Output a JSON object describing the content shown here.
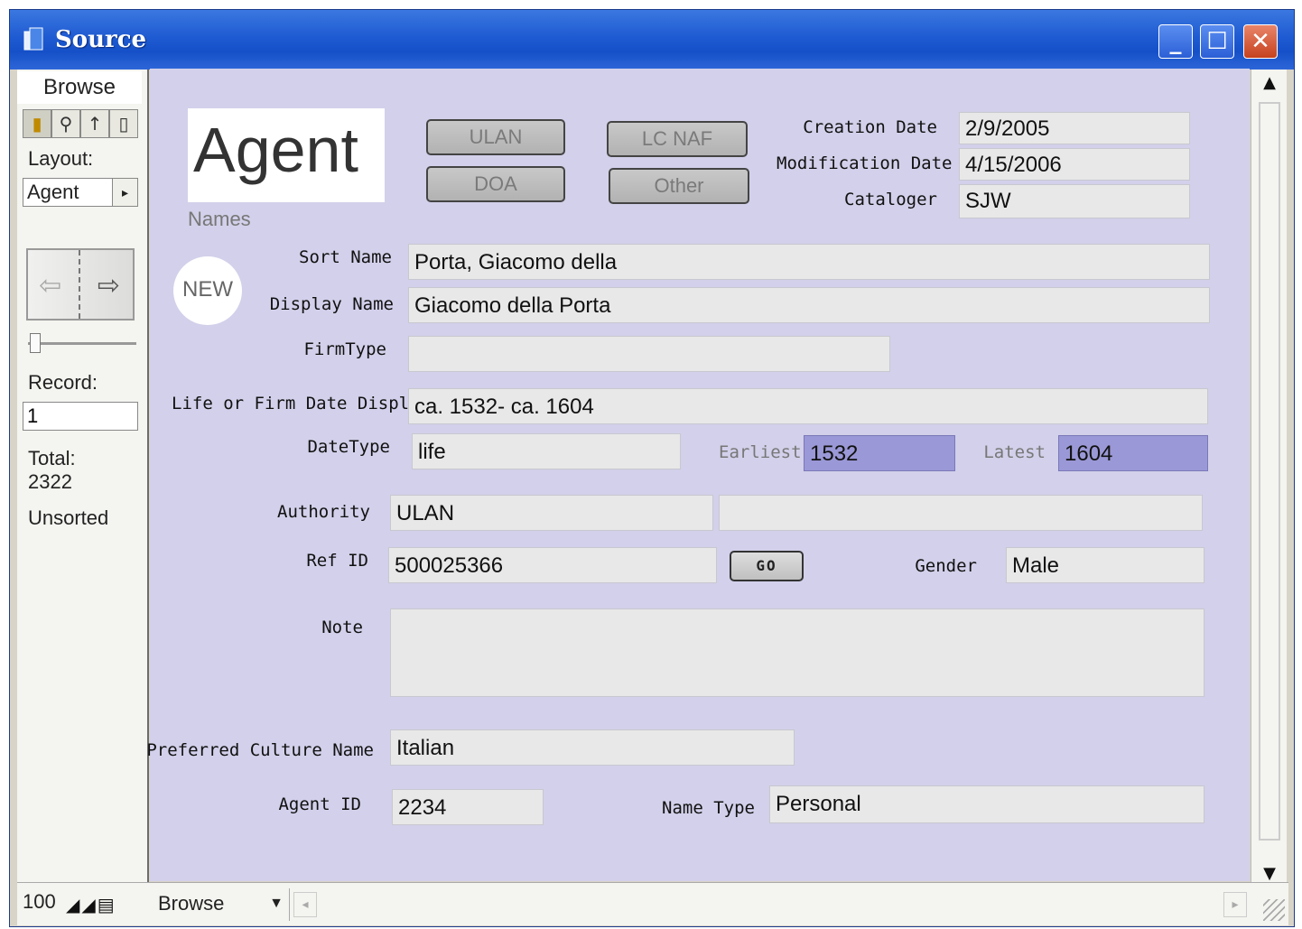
{
  "window": {
    "title": "Source",
    "title_icon": "filemaker-app-icon",
    "titlebar_color": "#1f5bd2"
  },
  "sidebar": {
    "mode": "Browse",
    "layout_label": "Layout:",
    "layout_value": "Agent",
    "record_label": "Record:",
    "record_value": "1",
    "total_label": "Total:",
    "total_value": "2322",
    "sort_status": "Unsorted"
  },
  "bottom": {
    "zoom": "100",
    "mode": "Browse"
  },
  "form": {
    "heading": "Agent",
    "section_label": "Names",
    "new_badge": "NEW",
    "buttons": {
      "ulan": "ULAN",
      "lcnaf": "LC NAF",
      "doa": "DOA",
      "other": "Other",
      "go": "GO"
    },
    "creation_date_label": "Creation Date",
    "creation_date": "2/9/2005",
    "modification_date_label": "Modification Date",
    "modification_date": "4/15/2006",
    "cataloger_label": "Cataloger",
    "cataloger": "SJW",
    "sort_name_label": "Sort Name",
    "sort_name": "Porta, Giacomo della",
    "display_name_label": "Display Name",
    "display_name": "Giacomo della Porta",
    "firm_type_label": "FirmType",
    "firm_type": "",
    "date_display_label": "Life or Firm Date Display",
    "date_display": "ca. 1532- ca. 1604",
    "date_type_label": "DateType",
    "date_type": "life",
    "earliest_label": "Earliest",
    "earliest": "1532",
    "latest_label": "Latest",
    "latest": "1604",
    "authority_label": "Authority",
    "authority": "ULAN",
    "authority_extra": "",
    "ref_id_label": "Ref ID",
    "ref_id": "500025366",
    "gender_label": "Gender",
    "gender": "Male",
    "note_label": "Note",
    "note": "",
    "culture_label": "Preferred Culture Name",
    "culture": "Italian",
    "agent_id_label": "Agent ID",
    "agent_id": "2234",
    "name_type_label": "Name Type",
    "name_type": "Personal"
  },
  "colors": {
    "form_bg": "#d2d0ea",
    "field_bg": "#e8e8e8",
    "highlight_field": "#9a98d6"
  }
}
